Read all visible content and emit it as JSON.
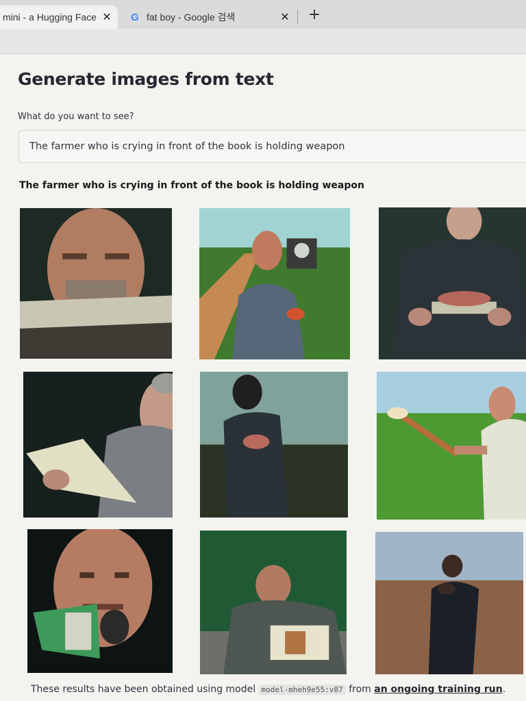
{
  "browser": {
    "tabs": [
      {
        "title": "mini - a Hugging Face S",
        "active": true
      },
      {
        "title": "fat boy - Google 검색",
        "active": false
      }
    ],
    "new_tab_symbol": "+",
    "close_symbol": "✕",
    "google_icon_letter": "G"
  },
  "page": {
    "title": "Generate images from text",
    "prompt_label": "What do you want to see?",
    "prompt_value": "The farmer who is crying in front of the book is holding weapon",
    "caption": "The farmer who is crying in front of the book is holding weapon",
    "images": [
      "farmer-face-behind-book",
      "farmer-in-crop-field-with-tractor",
      "man-holding-book-dark-background",
      "man-opening-book-in-profile",
      "man-standing-in-dark-field",
      "bald-man-swinging-axe-in-grass",
      "man-close-up-holding-money-book",
      "man-reading-book-green-background",
      "figure-in-dry-wheat-field"
    ],
    "footer": {
      "prefix": "These results have been obtained using model",
      "model": "model-mheh9e55:v87",
      "middle": "from",
      "link": "an ongoing training run",
      "suffix": "."
    }
  },
  "colors": {
    "page_background": "#f3f3f0",
    "text": "#31333f",
    "input_border": "#d5d5d5"
  }
}
